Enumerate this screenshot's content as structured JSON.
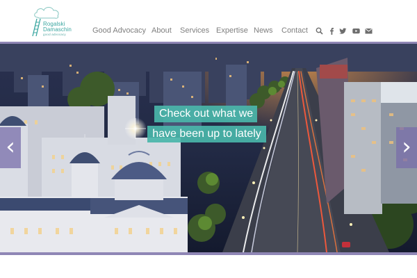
{
  "brand": {
    "name_line1": "Rogalski",
    "name_line2": "Damaschin",
    "tagline": "good advocacy"
  },
  "nav": {
    "items": [
      {
        "label": "Good Advocacy"
      },
      {
        "label": "About"
      },
      {
        "label": "Services"
      },
      {
        "label": "Expertise"
      },
      {
        "label": "News"
      },
      {
        "label": "Contact"
      }
    ]
  },
  "social": {
    "icons": [
      "search-icon",
      "facebook-icon",
      "twitter-icon",
      "youtube-icon",
      "email-icon"
    ]
  },
  "hero": {
    "caption_line1": "Check out what we",
    "caption_line2": "have been up to lately",
    "prev_label": "‹",
    "next_label": "›"
  },
  "colors": {
    "accent": "#4ab6aa",
    "nav_text": "#7f7f7f",
    "slider_bar": "#8f86b5"
  }
}
